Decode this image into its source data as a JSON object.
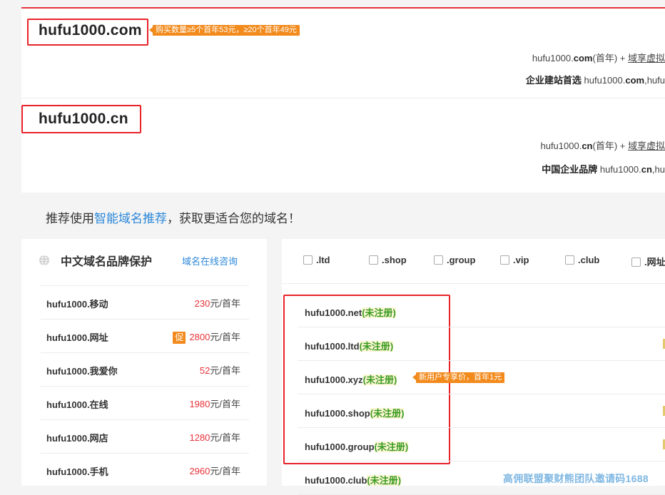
{
  "cards": [
    {
      "domain": "hufu1000.com",
      "promo": "购买数量≥5个首年53元，≥20个首年49元",
      "line1_pre": "hufu1000.",
      "line1_ext": "com",
      "line1_post": "(首年) + ",
      "line1_link": "域享虚拟",
      "line2_bold": "企业建站首选",
      "line2_pre": " hufu1000.",
      "line2_ext": "com",
      "line2_post": ",hufu"
    },
    {
      "domain": "hufu1000.cn",
      "line1_pre": "hufu1000.",
      "line1_ext": "cn",
      "line1_post": "(首年) + ",
      "line1_link": "域享虚拟",
      "line2_bold": "中国企业品牌",
      "line2_pre": " hufu1000.",
      "line2_ext": "cn",
      "line2_post": ",hu"
    }
  ],
  "recommend": {
    "prefix": "推荐使用",
    "link": "智能域名推荐",
    "suffix": "，获取更适合您的域名！"
  },
  "left_panel": {
    "icon": "globe-icon",
    "title": "中文域名品牌保护",
    "consult_link": "域名在线咨询",
    "price_unit": "元/首年",
    "items": [
      {
        "name": "hufu1000.移动",
        "price": "230",
        "promo": ""
      },
      {
        "name": "hufu1000.网址",
        "price": "2800",
        "promo": "促"
      },
      {
        "name": "hufu1000.我爱你",
        "price": "52",
        "promo": ""
      },
      {
        "name": "hufu1000.在线",
        "price": "1980",
        "promo": ""
      },
      {
        "name": "hufu1000.网店",
        "price": "1280",
        "promo": ""
      },
      {
        "name": "hufu1000.手机",
        "price": "2960",
        "promo": ""
      }
    ]
  },
  "right_panel": {
    "extensions": [
      ".ltd",
      ".shop",
      ".group",
      ".vip",
      ".club",
      ".网址"
    ],
    "status_label": "(未注册)",
    "new_user_promo": "新用户专享价，首年1元",
    "results": [
      {
        "domain": "hufu1000.net"
      },
      {
        "domain": "hufu1000.ltd"
      },
      {
        "domain": "hufu1000.xyz"
      },
      {
        "domain": "hufu1000.shop"
      },
      {
        "domain": "hufu1000.group"
      },
      {
        "domain": "hufu1000.club"
      }
    ]
  },
  "watermark": "高佣联盟聚财熊团队邀请码1688",
  "colors": {
    "accent_red": "#e8333a",
    "link_blue": "#2b87d8",
    "promo_orange": "#f28a1c",
    "status_green": "#3a9b22"
  }
}
